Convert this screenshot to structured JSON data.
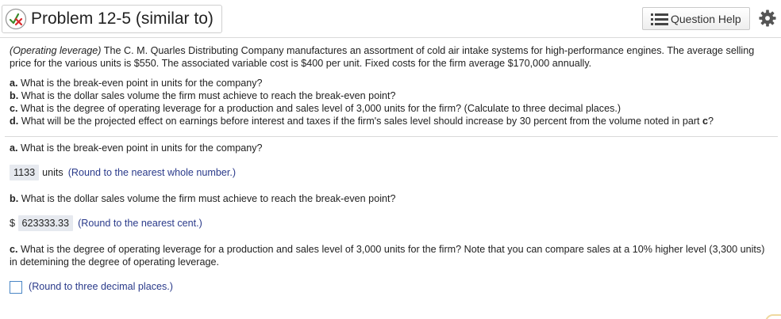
{
  "header": {
    "title": "Problem 12-5 (similar to)",
    "status_icon": "partial-credit-icon",
    "question_help_label": "Question Help",
    "list_icon": "list-icon",
    "gear_icon": "gear-icon"
  },
  "problem": {
    "topic": "(Operating leverage)",
    "intro": " The C. M. Quarles Distributing Company manufactures an assortment of cold air intake systems for high-performance engines. The average selling price for the various units is $550. The associated variable cost is $400 per unit. Fixed costs for the firm average $170,000 annually.",
    "parts": [
      {
        "letter": "a.",
        "text": " What is the break-even point in units for the company?"
      },
      {
        "letter": "b.",
        "text": " What is the dollar sales volume the firm must achieve to reach the break-even point?"
      },
      {
        "letter": "c.",
        "text": " What is the degree of operating leverage for a production and sales level of 3,000 units for the firm? (Calculate to three decimal places.)"
      },
      {
        "letter": "d.",
        "text": " What will be the projected effect on earnings before interest and taxes if the firm's sales level should increase by 30 percent from the volume noted in part "
      },
      {
        "letter_tail": "c",
        "tail_mark": "?"
      }
    ]
  },
  "answers": {
    "a": {
      "question_letter": "a.",
      "question": " What is the break-even point in units for the company?",
      "value": "1133",
      "units": "units",
      "hint": "(Round to the nearest whole number.)"
    },
    "b": {
      "question_letter": "b.",
      "question": " What is the dollar sales volume the firm must achieve to reach the break-even point?",
      "prefix": "$",
      "value": "623333.33",
      "hint": "(Round to the nearest cent.)"
    },
    "c": {
      "question_letter": "c.",
      "question": " What is the degree of operating leverage for a production and sales level of 3,000 units for the firm? Note that you can compare sales at a 10% higher level (3,300 units) in detemining the degree of operating leverage.",
      "value": "",
      "hint": "(Round to three decimal places.)"
    }
  },
  "colors": {
    "hint_text": "#2a3a8a",
    "answer_box_bg": "#e6e9ef",
    "input_border": "#4a86c5",
    "check_green": "#3a8a2a",
    "cross_red": "#d9292b"
  }
}
